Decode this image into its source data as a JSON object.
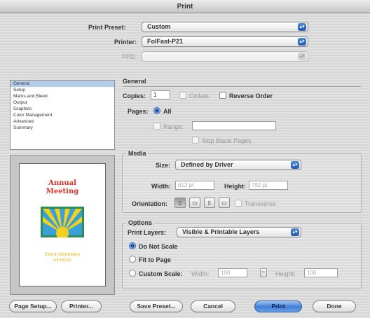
{
  "window": {
    "title": "Print"
  },
  "top": {
    "preset_label": "Print Preset:",
    "preset_value": "Custom",
    "printer_label": "Printer:",
    "printer_value": "FolFast-P21",
    "ppd_label": "PPD:",
    "ppd_value": ""
  },
  "sidebar": {
    "items": [
      {
        "label": "General",
        "selected": true
      },
      {
        "label": "Setup",
        "selected": false
      },
      {
        "label": "Marks and Bleed",
        "selected": false
      },
      {
        "label": "Output",
        "selected": false
      },
      {
        "label": "Graphics",
        "selected": false
      },
      {
        "label": "Color Management",
        "selected": false
      },
      {
        "label": "Advanced",
        "selected": false
      },
      {
        "label": "Summary",
        "selected": false
      }
    ]
  },
  "preview": {
    "line1": "Annual",
    "line2": "Meeting",
    "footer1": "Event information",
    "footer2": "All Hosts",
    "colors": {
      "title": "#e0302a",
      "footer": "#f0b400",
      "image_bg": "#3aa0d8",
      "image_sun": "#f2d11e",
      "image_frame": "#2d8f56"
    }
  },
  "general": {
    "section_title": "General",
    "copies_label": "Copies:",
    "copies_value": "1",
    "collate_label": "Collate",
    "reverse_label": "Reverse Order",
    "pages_label": "Pages:",
    "all_label": "All",
    "range_label": "Range:",
    "range_value": "",
    "skip_label": "Skip Blank Pages"
  },
  "media": {
    "section_title": "Media",
    "size_label": "Size:",
    "size_value": "Defined by Driver",
    "width_label": "Width:",
    "width_value": "612 pt",
    "height_label": "Height:",
    "height_value": "792 pt",
    "orientation_label": "Orientation:",
    "transverse_label": "Transverse"
  },
  "options": {
    "section_title": "Options",
    "layers_label": "Print Layers:",
    "layers_value": "Visible & Printable Layers",
    "no_scale_label": "Do Not Scale",
    "fit_label": "Fit to Page",
    "custom_label": "Custom Scale:",
    "width_label": "Width:",
    "width_value": "100",
    "height_label": "Height:",
    "height_value": "100"
  },
  "buttons": {
    "page_setup": "Page Setup...",
    "printer": "Printer...",
    "save_preset": "Save Preset...",
    "cancel": "Cancel",
    "print": "Print",
    "done": "Done"
  }
}
